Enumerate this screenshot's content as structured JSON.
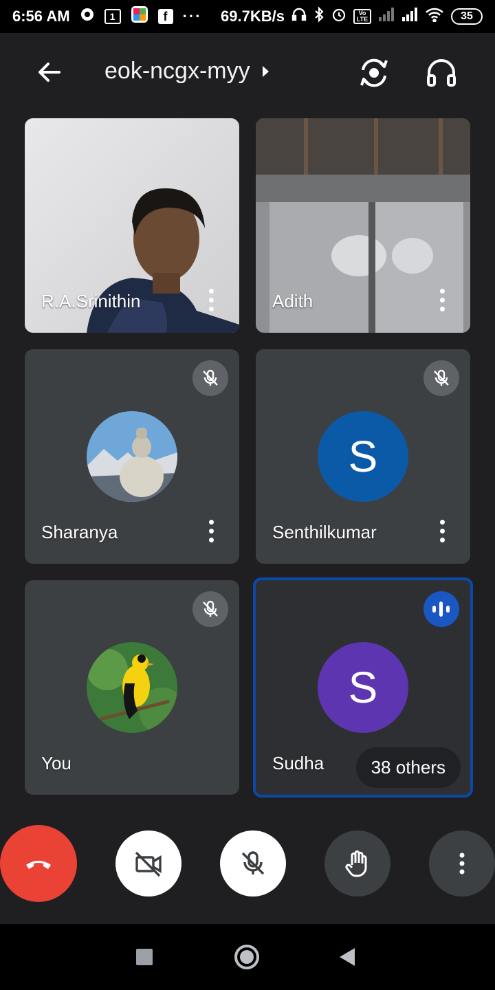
{
  "status_bar": {
    "time": "6:56 AM",
    "notif_box": "1",
    "overflow": "···",
    "net_speed": "69.7KB/s",
    "volte": "Vo LTE",
    "battery": "35"
  },
  "header": {
    "meeting_code": "eok-ncgx-myy"
  },
  "participants": [
    {
      "name": "R.A.Srinithin",
      "video": true,
      "muted": false
    },
    {
      "name": "Adith",
      "video": true,
      "muted": false
    },
    {
      "name": "Sharanya",
      "video": false,
      "muted": true,
      "avatar": "shiva-statue-photo"
    },
    {
      "name": "Senthilkumar",
      "video": false,
      "muted": true,
      "initial": "S",
      "avatar_color": "#0b5aa8"
    },
    {
      "name": "You",
      "video": false,
      "muted": true,
      "avatar": "goldfinch-bird-photo"
    },
    {
      "name": "Sudha",
      "video": false,
      "speaking": true,
      "initial": "S",
      "avatar_color": "#5e35b1",
      "others_label": "38 others"
    }
  ],
  "controls": {
    "end_call": "end-call",
    "camera": "camera-off",
    "mic": "mic-off",
    "raise_hand": "raise-hand",
    "more": "more-options"
  },
  "colors": {
    "end_call": "#ea4335",
    "speaking_border": "#0b48a8",
    "background": "#1f1f21"
  }
}
